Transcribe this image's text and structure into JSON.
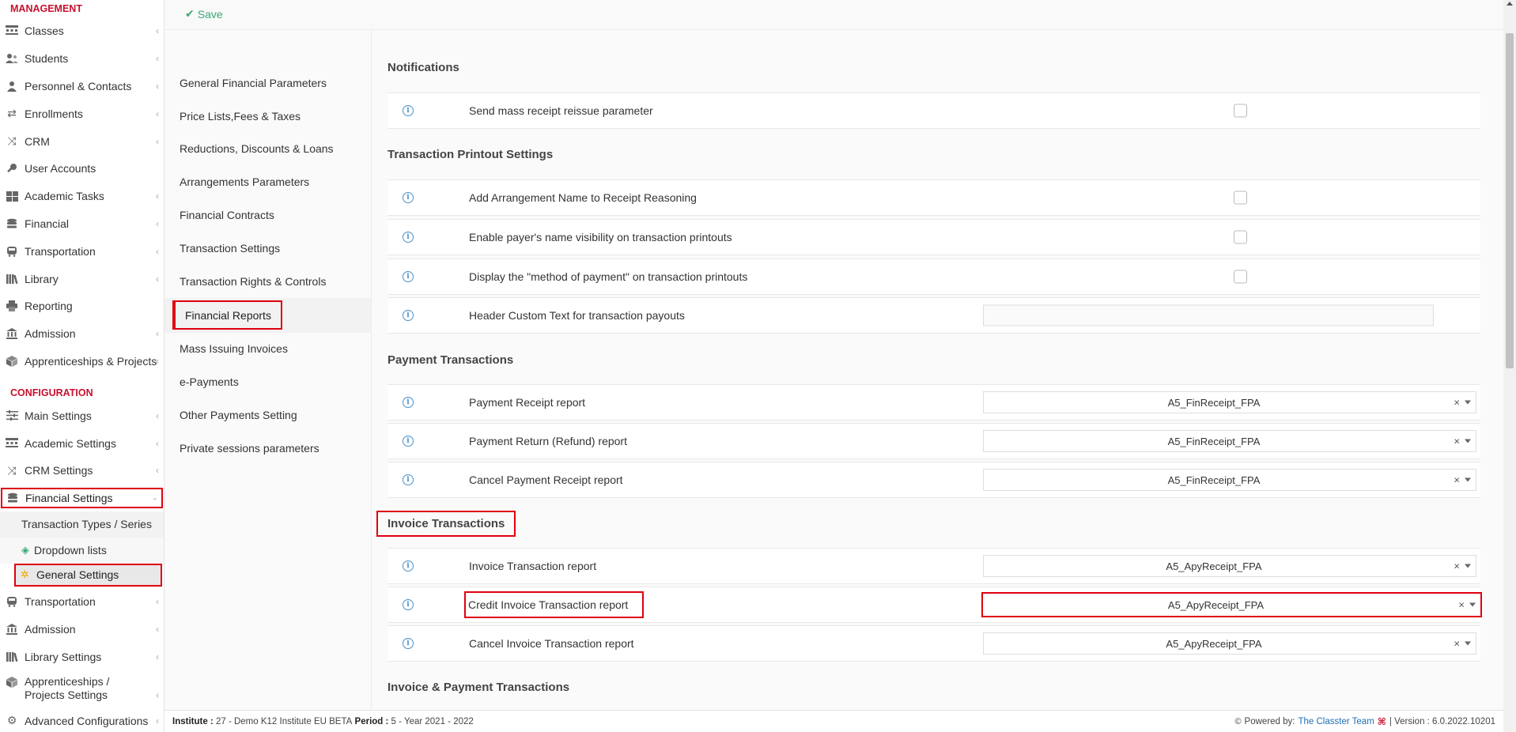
{
  "toolbar": {
    "save_label": "Save"
  },
  "sidebar": {
    "management_title": "MANAGEMENT",
    "management_items": [
      {
        "label": "Classes",
        "icon": "classes-icon"
      },
      {
        "label": "Students",
        "icon": "students-icon"
      },
      {
        "label": "Personnel & Contacts",
        "icon": "personnel-icon"
      },
      {
        "label": "Enrollments",
        "icon": "enrollments-icon"
      },
      {
        "label": "CRM",
        "icon": "crm-icon"
      },
      {
        "label": "User Accounts",
        "icon": "key-icon"
      },
      {
        "label": "Academic Tasks",
        "icon": "tasks-icon"
      },
      {
        "label": "Financial",
        "icon": "coins-icon"
      },
      {
        "label": "Transportation",
        "icon": "bus-icon"
      },
      {
        "label": "Library",
        "icon": "library-icon"
      },
      {
        "label": "Reporting",
        "icon": "printer-icon"
      },
      {
        "label": "Admission",
        "icon": "institution-icon"
      },
      {
        "label": "Apprenticeships & Projects",
        "icon": "box-icon"
      }
    ],
    "configuration_title": "CONFIGURATION",
    "config_items": [
      {
        "label": "Main Settings",
        "icon": "sliders-icon"
      },
      {
        "label": "Academic Settings",
        "icon": "classes-icon"
      },
      {
        "label": "CRM Settings",
        "icon": "crm-icon"
      },
      {
        "label": "Financial Settings",
        "icon": "coins-icon"
      }
    ],
    "financial_sub": [
      {
        "label": "Transaction Types / Series"
      },
      {
        "label": "Dropdown lists",
        "icon": "layers-icon"
      },
      {
        "label": "General Settings",
        "icon": "gear-icon"
      }
    ],
    "config_items_after": [
      {
        "label": "Transportation",
        "icon": "bus-icon"
      },
      {
        "label": "Admission",
        "icon": "institution-icon"
      },
      {
        "label": "Library Settings",
        "icon": "library-icon"
      },
      {
        "label": "Apprenticeships / Projects Settings",
        "icon": "box-icon"
      },
      {
        "label": "Advanced Configurations",
        "icon": "gears-icon"
      }
    ]
  },
  "midnav": {
    "items": [
      "General Financial Parameters",
      "Price Lists,Fees & Taxes",
      "Reductions, Discounts & Loans",
      "Arrangements Parameters",
      "Financial Contracts",
      "Transaction Settings",
      "Transaction Rights & Controls",
      "Financial Reports",
      "Mass Issuing Invoices",
      "e-Payments",
      "Other Payments Setting",
      "Private sessions parameters"
    ],
    "active": "Financial Reports"
  },
  "main": {
    "sections": {
      "notifications": "Notifications",
      "printout": "Transaction Printout Settings",
      "payment": "Payment Transactions",
      "invoice": "Invoice Transactions",
      "invoice_payment": "Invoice & Payment Transactions"
    },
    "rows": {
      "mass_receipt": "Send mass receipt reissue parameter",
      "arrangement_name": "Add Arrangement Name to Receipt Reasoning",
      "payer_name": "Enable payer's name visibility on transaction printouts",
      "method_payment": "Display the \"method of payment\" on transaction printouts",
      "header_text": "Header Custom Text for transaction payouts",
      "payment_receipt": "Payment Receipt report",
      "payment_return": "Payment Return (Refund) report",
      "cancel_payment": "Cancel Payment Receipt report",
      "invoice_report": "Invoice Transaction report",
      "credit_invoice": "Credit Invoice Transaction report",
      "cancel_invoice": "Cancel Invoice Transaction report"
    },
    "values": {
      "payment_receipt": "A5_FinReceipt_FPA",
      "payment_return": "A5_FinReceipt_FPA",
      "cancel_payment": "A5_FinReceipt_FPA",
      "invoice_report": "A5_ApyReceipt_FPA",
      "credit_invoice": "A5_ApyReceipt_FPA",
      "cancel_invoice": "A5_ApyReceipt_FPA"
    },
    "clear_glyph": "×",
    "info_glyph": "i"
  },
  "footer": {
    "institute_label": "Institute :",
    "institute_value": "27 - Demo K12 Institute EU BETA",
    "period_label": "Period :",
    "period_value": "5 - Year 2021 - 2022",
    "powered_label": "Powered by:",
    "powered_link": "The Classter Team",
    "version": "| Version : 6.0.2022.10201"
  },
  "colors": {
    "accent_red": "#c8102e",
    "highlight_red": "#e0000f",
    "save_green": "#3aa876",
    "info_blue": "#4a90c8",
    "link_blue": "#1d6fb8"
  }
}
